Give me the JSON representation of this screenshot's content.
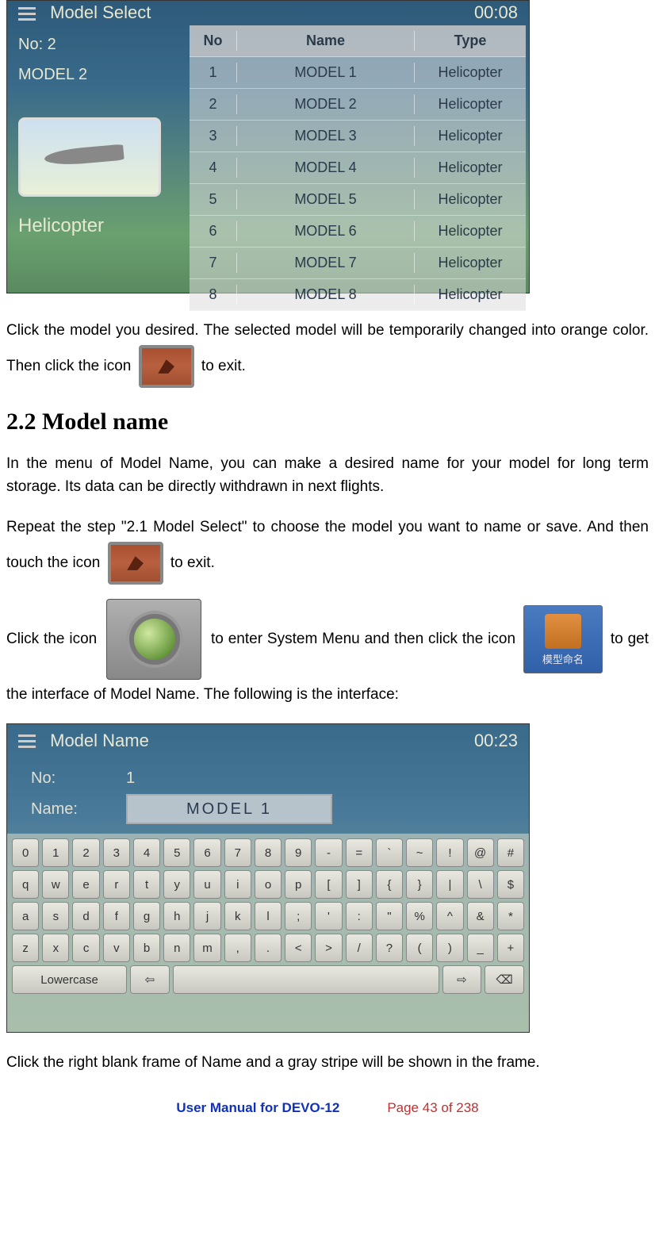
{
  "screenshot1": {
    "title": "Model Select",
    "clock": "00:08",
    "current_no_label": "No: 2",
    "current_model_label": "MODEL 2",
    "type_label": "Helicopter",
    "table": {
      "headers": {
        "no": "No",
        "name": "Name",
        "type": "Type"
      },
      "rows": [
        {
          "no": "1",
          "name": "MODEL 1",
          "type": "Helicopter"
        },
        {
          "no": "2",
          "name": "MODEL 2",
          "type": "Helicopter"
        },
        {
          "no": "3",
          "name": "MODEL 3",
          "type": "Helicopter"
        },
        {
          "no": "4",
          "name": "MODEL 4",
          "type": "Helicopter"
        },
        {
          "no": "5",
          "name": "MODEL 5",
          "type": "Helicopter"
        },
        {
          "no": "6",
          "name": "MODEL 6",
          "type": "Helicopter"
        },
        {
          "no": "7",
          "name": "MODEL 7",
          "type": "Helicopter"
        },
        {
          "no": "8",
          "name": "MODEL 8",
          "type": "Helicopter"
        }
      ]
    }
  },
  "body": {
    "para1a": "Click the model you desired. The selected model will be temporarily changed into orange color. Then click the icon ",
    "para1b": " to exit.",
    "heading": "2.2 Model name",
    "para2": "In the menu of Model Name, you can make a desired name for your model for long term storage. Its data can be directly withdrawn in next flights.",
    "para3a": "Repeat the step \"2.1 Model Select\" to choose the model you want to name or save. And then touch the icon ",
    "para3b": " to exit.",
    "para4a": "Click the icon ",
    "para4b": " to enter System Menu and then click the icon ",
    "para4c": " to get the interface of Model Name. The following is the interface:",
    "modelname_icon_label": "模型命名"
  },
  "screenshot2": {
    "title": "Model Name",
    "clock": "00:23",
    "no_label": "No:",
    "no_value": "1",
    "name_label": "Name:",
    "name_value": "MODEL  1",
    "keyboard": {
      "row1": [
        "0",
        "1",
        "2",
        "3",
        "4",
        "5",
        "6",
        "7",
        "8",
        "9",
        "-",
        "=",
        "`",
        "~",
        "!",
        "@",
        "#"
      ],
      "row2": [
        "q",
        "w",
        "e",
        "r",
        "t",
        "y",
        "u",
        "i",
        "o",
        "p",
        "[",
        "]",
        "{",
        "}",
        "|",
        "\\",
        "$"
      ],
      "row3": [
        "a",
        "s",
        "d",
        "f",
        "g",
        "h",
        "j",
        "k",
        "l",
        ";",
        "'",
        ":",
        "\"",
        "%",
        "^",
        "&",
        "*"
      ],
      "row4": [
        "z",
        "x",
        "c",
        "v",
        "b",
        "n",
        "m",
        ",",
        ".",
        "<",
        ">",
        "/",
        "?",
        "(",
        ")",
        "_",
        "+"
      ],
      "row5": {
        "mode": "Lowercase",
        "left": "⇦",
        "space": "",
        "right": "⇨",
        "back": "⌫"
      }
    }
  },
  "body2": {
    "para5": "Click the right blank frame of Name and a gray stripe will be shown in the frame."
  },
  "footer": {
    "left": "User Manual for DEVO-12",
    "right": "Page 43 of 238"
  }
}
